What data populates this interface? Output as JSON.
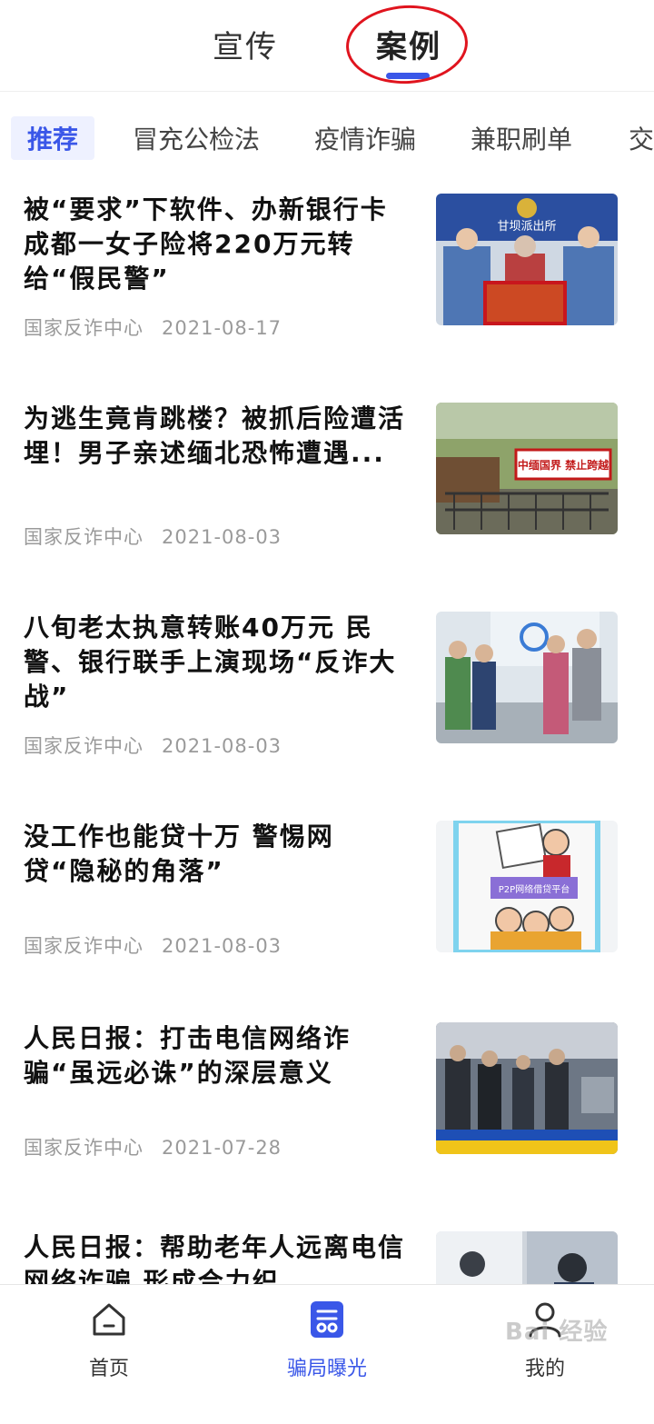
{
  "top_tabs": [
    {
      "label": "宣传"
    },
    {
      "label": "案例",
      "active": true
    }
  ],
  "categories": [
    {
      "label": "推荐",
      "active": true
    },
    {
      "label": "冒充公检法"
    },
    {
      "label": "疫情诈骗"
    },
    {
      "label": "兼职刷单"
    },
    {
      "label": "交"
    }
  ],
  "articles": [
    {
      "title": "被“要求”下软件、办新银行卡 成都一女子险将220万元转给“假民警”",
      "source": "国家反诈中心",
      "date": "2021-08-17"
    },
    {
      "title": "为逃生竟肯跳楼？被抓后险遭活埋！男子亲述缅北恐怖遭遇...",
      "source": "国家反诈中心",
      "date": "2021-08-03"
    },
    {
      "title": "八旬老太执意转账40万元 民警、银行联手上演现场“反诈大战”",
      "source": "国家反诈中心",
      "date": "2021-08-03"
    },
    {
      "title": "没工作也能贷十万 警惕网贷“隐秘的角落”",
      "source": "国家反诈中心",
      "date": "2021-08-03"
    },
    {
      "title": "人民日报：打击电信网络诈骗“虽远必诛”的深层意义",
      "source": "国家反诈中心",
      "date": "2021-07-28"
    },
    {
      "title": "人民日报：帮助老年人远离电信网络诈骗 形成合力织",
      "source": "",
      "date": ""
    }
  ],
  "thumb_texts": {
    "police_sign": "甘坝派出所",
    "border_sign": "中缅国界 禁止跨越",
    "loan_sign": "P2P网络借贷平台"
  },
  "bottom_nav": [
    {
      "label": "首页",
      "icon": "home-icon"
    },
    {
      "label": "骗局曝光",
      "icon": "exposure-icon",
      "active": true
    },
    {
      "label": "我的",
      "icon": "user-icon"
    }
  ],
  "watermark": "Bai 经验",
  "colors": {
    "accent": "#3a57e8",
    "highlight_circle": "#e0141e",
    "meta": "#9a9a9a"
  }
}
